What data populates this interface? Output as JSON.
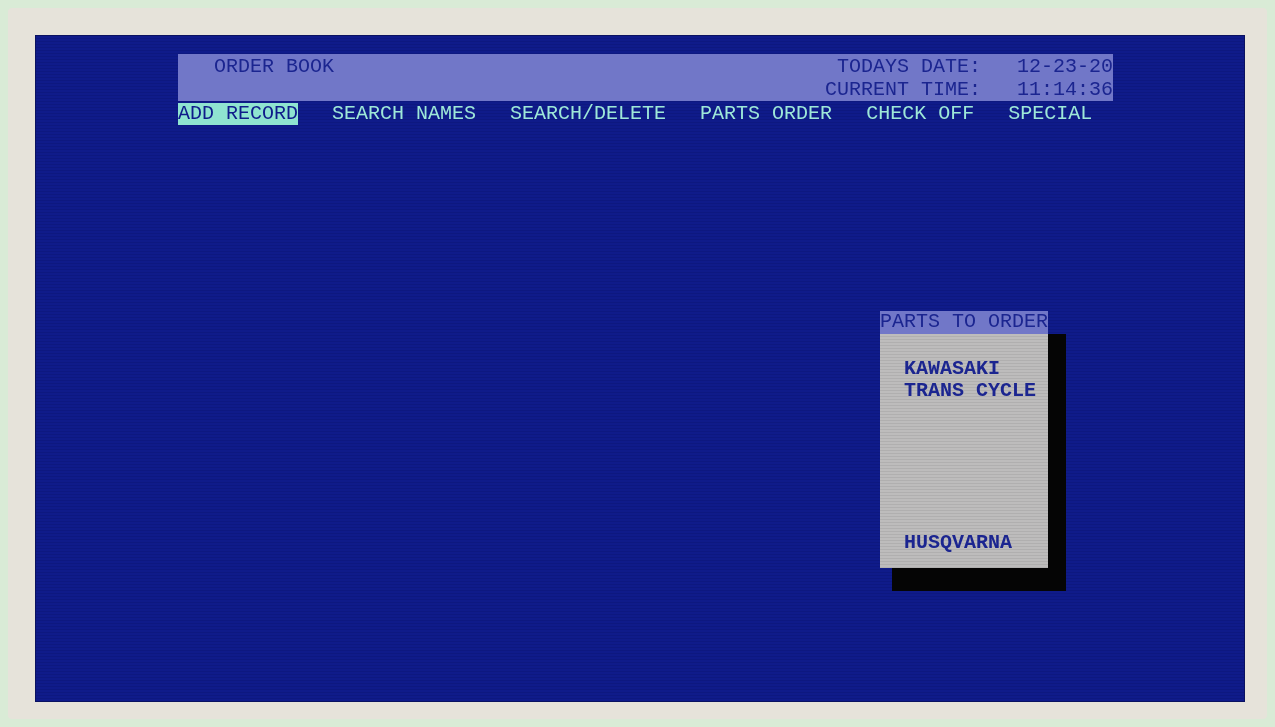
{
  "header": {
    "title": "ORDER BOOK",
    "date_label": "TODAYS DATE:",
    "date": "12-23-20",
    "time_label": "CURRENT TIME:",
    "time": "11:14:36"
  },
  "menu": [
    {
      "label": "ADD RECORD",
      "selected": true
    },
    {
      "label": "SEARCH NAMES",
      "selected": false
    },
    {
      "label": "SEARCH/DELETE",
      "selected": false
    },
    {
      "label": "PARTS ORDER",
      "selected": false
    },
    {
      "label": "CHECK OFF",
      "selected": false
    },
    {
      "label": "SPECIAL",
      "selected": false
    }
  ],
  "parts_panel": {
    "title": "PARTS TO ORDER",
    "items": [
      "KAWASAKI",
      "TRANS CYCLE",
      "HUSQVARNA"
    ]
  }
}
